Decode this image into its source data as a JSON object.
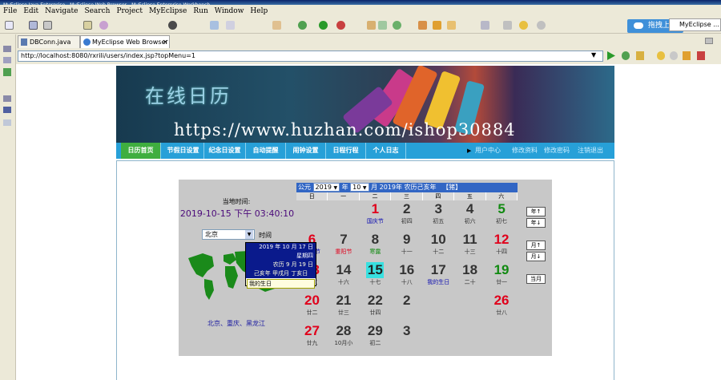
{
  "window": {
    "title": "MyEclipse Java Enterprise - MyEclipse Web Browser - MyEclipse Enterprise Workbench"
  },
  "menu": [
    "File",
    "Edit",
    "Navigate",
    "Search",
    "Project",
    "MyEclipse",
    "Run",
    "Window",
    "Help"
  ],
  "toolbar": {
    "upload_label": "拖拽上传",
    "perspective": "MyEclipse ..."
  },
  "tabs": [
    {
      "label": "DBConn.java"
    },
    {
      "label": "MyEclipse Web Browser"
    }
  ],
  "address": {
    "url": "http://localhost:8080/rxrili/users/index.jsp?topMenu=1"
  },
  "site": {
    "title": "在线日历",
    "watermark": "https://www.huzhan.com/ishop30884",
    "nav": [
      "日历首页",
      "节假日设置",
      "纪念日设置",
      "自动提醒",
      "闹钟设置",
      "日程行程",
      "个人日志"
    ],
    "nav_right": [
      "用户中心",
      "修改资料",
      "修改密码",
      "注销退出"
    ]
  },
  "clock": {
    "label": "当地时间:",
    "datetime": "2019-10-15 下午  03:40:10",
    "city": "北京",
    "city_suffix": "时间",
    "cities_caption": "北京、重庆、黑龙江"
  },
  "calendar": {
    "era": "公元",
    "year": "2019",
    "year_unit": "年",
    "month": "10",
    "month_unit": "月",
    "header_text": "2019年 农历己亥年",
    "zodiac": "【猪】",
    "weekdays": [
      "日",
      "一",
      "二",
      "三",
      "四",
      "五",
      "六"
    ],
    "colors": {
      "red": "#e0001b",
      "green": "#118a11",
      "black": "#333333",
      "today": "#38e0e0",
      "blue": "#1010b0"
    },
    "days": [
      {
        "d": "1",
        "l": "国庆节",
        "dc": "red",
        "lc": "blue",
        "col": 2,
        "row": 0
      },
      {
        "d": "2",
        "l": "初四",
        "dc": "black",
        "lc": "black",
        "col": 3,
        "row": 0
      },
      {
        "d": "3",
        "l": "初五",
        "dc": "black",
        "lc": "black",
        "col": 4,
        "row": 0
      },
      {
        "d": "4",
        "l": "初六",
        "dc": "black",
        "lc": "black",
        "col": 5,
        "row": 0
      },
      {
        "d": "5",
        "l": "初七",
        "dc": "green",
        "lc": "black",
        "col": 6,
        "row": 0
      },
      {
        "d": "6",
        "l": "老人节",
        "dc": "red",
        "lc": "blue",
        "col": 0,
        "row": 1
      },
      {
        "d": "7",
        "l": "重阳节",
        "dc": "black",
        "lc": "red",
        "col": 1,
        "row": 1
      },
      {
        "d": "8",
        "l": "寒露",
        "dc": "black",
        "lc": "green",
        "col": 2,
        "row": 1
      },
      {
        "d": "9",
        "l": "十一",
        "dc": "black",
        "lc": "black",
        "col": 3,
        "row": 1
      },
      {
        "d": "10",
        "l": "十二",
        "dc": "black",
        "lc": "black",
        "col": 4,
        "row": 1
      },
      {
        "d": "11",
        "l": "十三",
        "dc": "black",
        "lc": "black",
        "col": 5,
        "row": 1
      },
      {
        "d": "12",
        "l": "十四",
        "dc": "red",
        "lc": "black",
        "col": 6,
        "row": 1
      },
      {
        "d": "13",
        "l": "十五",
        "dc": "red",
        "lc": "black",
        "col": 0,
        "row": 2
      },
      {
        "d": "14",
        "l": "十六",
        "dc": "black",
        "lc": "black",
        "col": 1,
        "row": 2
      },
      {
        "d": "15",
        "l": "十七",
        "dc": "black",
        "lc": "black",
        "col": 2,
        "row": 2,
        "today": true
      },
      {
        "d": "16",
        "l": "十八",
        "dc": "black",
        "lc": "black",
        "col": 3,
        "row": 2
      },
      {
        "d": "17",
        "l": "我的生日",
        "dc": "black",
        "lc": "blue",
        "col": 4,
        "row": 2
      },
      {
        "d": "18",
        "l": "二十",
        "dc": "black",
        "lc": "black",
        "col": 5,
        "row": 2
      },
      {
        "d": "19",
        "l": "廿一",
        "dc": "green",
        "lc": "black",
        "col": 6,
        "row": 2
      },
      {
        "d": "20",
        "l": "廿二",
        "dc": "red",
        "lc": "black",
        "col": 0,
        "row": 3
      },
      {
        "d": "21",
        "l": "廿三",
        "dc": "black",
        "lc": "black",
        "col": 1,
        "row": 3
      },
      {
        "d": "22",
        "l": "廿四",
        "dc": "black",
        "lc": "black",
        "col": 2,
        "row": 3
      },
      {
        "d": "2",
        "l": "",
        "dc": "black",
        "lc": "black",
        "col": 3,
        "row": 3
      },
      {
        "d": "26",
        "l": "廿八",
        "dc": "red",
        "lc": "black",
        "col": 6,
        "row": 3
      },
      {
        "d": "27",
        "l": "廿九",
        "dc": "red",
        "lc": "black",
        "col": 0,
        "row": 4
      },
      {
        "d": "28",
        "l": "10月小",
        "dc": "black",
        "lc": "black",
        "col": 1,
        "row": 4
      },
      {
        "d": "29",
        "l": "初二",
        "dc": "black",
        "lc": "black",
        "col": 2,
        "row": 4
      },
      {
        "d": "3",
        "l": "",
        "dc": "black",
        "lc": "black",
        "col": 3,
        "row": 4
      }
    ],
    "buttons": [
      "年↑",
      "年↓",
      "月↑",
      "月↓",
      "当月"
    ]
  },
  "tooltip": {
    "date": "2019 年 10 月 17 日",
    "weekday": "星期四",
    "lunar": "农历 9 月 19 日",
    "ganzhi": "己亥年 甲戌月 丁亥日",
    "note": "我的生日"
  }
}
